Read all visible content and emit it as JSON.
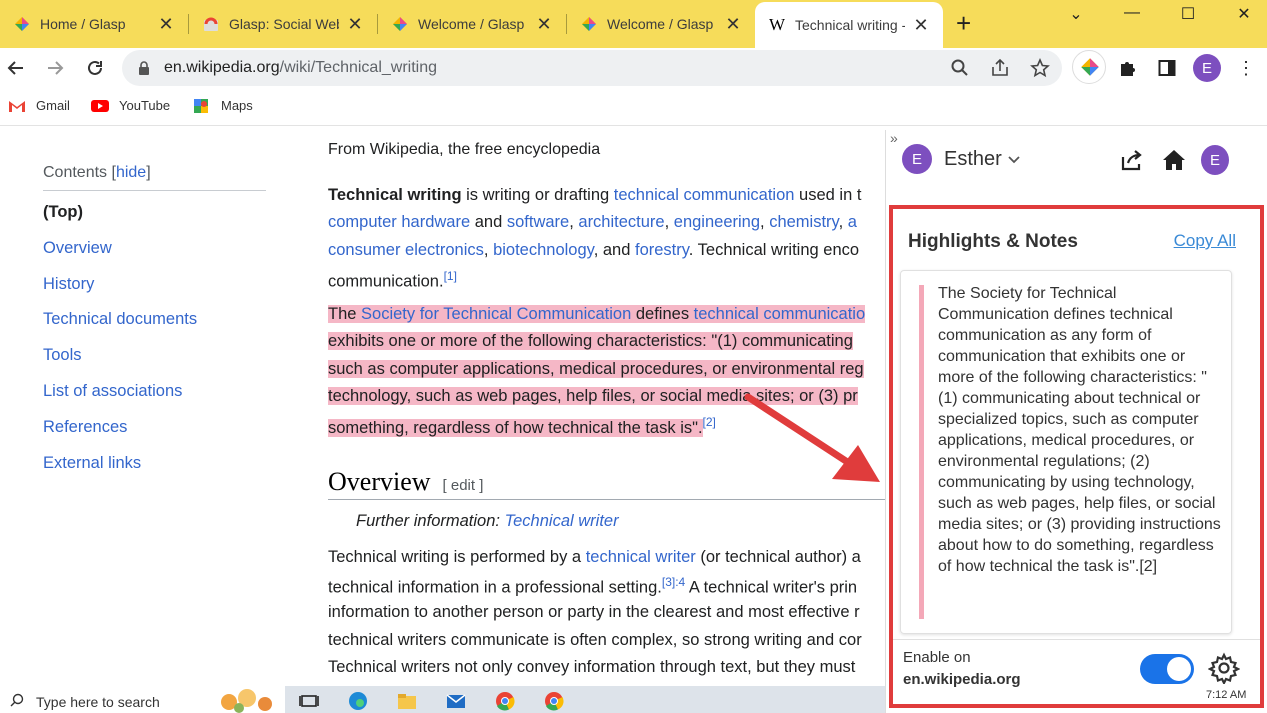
{
  "browser": {
    "tabs": [
      {
        "title": "Home / Glasp",
        "icon": "glasp-icon"
      },
      {
        "title": "Glasp: Social Web",
        "icon": "chrome-store-icon"
      },
      {
        "title": "Welcome / Glasp",
        "icon": "glasp-icon"
      },
      {
        "title": "Welcome / Glasp",
        "icon": "glasp-icon"
      },
      {
        "title": "Technical writing -",
        "icon": "wikipedia-icon"
      }
    ],
    "new_tab": "+",
    "window_controls": {
      "collapse": "⌄",
      "minimize": "—",
      "maximize": "☐",
      "close": "✕"
    },
    "url_host": "en.wikipedia.org",
    "url_path": "/wiki/Technical_writing",
    "profile_initial": "E",
    "bookmarks": [
      {
        "label": "Gmail",
        "icon": "gmail-icon"
      },
      {
        "label": "YouTube",
        "icon": "youtube-icon"
      },
      {
        "label": "Maps",
        "icon": "maps-icon"
      }
    ]
  },
  "wiki": {
    "toc": {
      "heading": "Contents",
      "toggle": "hide",
      "items": [
        "(Top)",
        "Overview",
        "History",
        "Technical documents",
        "Tools",
        "List of associations",
        "References",
        "External links"
      ]
    },
    "tagline": "From Wikipedia, the free encyclopedia",
    "p1": {
      "bold": "Technical writing",
      "t1": " is writing or drafting ",
      "l1": "technical communication",
      "t2": " used in t",
      "l2": "computer hardware",
      "t3": " and ",
      "l3": "software",
      "t4": ", ",
      "l4": "architecture",
      "t5": ", ",
      "l5": "engineering",
      "t6": ", ",
      "l6": "chemistry",
      "t7": ", ",
      "l7": "a",
      "l8": "consumer electronics",
      "t8": ", ",
      "l9": "biotechnology",
      "t9": ", and ",
      "l10": "forestry",
      "t10": ". Technical writing enco",
      "t11": "communication.",
      "sup": "[1]"
    },
    "p2": {
      "t1": "The ",
      "l1": "Society for Technical Communication",
      "t2": " defines ",
      "l2": "technical communicatio",
      "line2": "exhibits one or more of the following characteristics: \"(1) communicating ",
      "line3": "such as computer applications, medical procedures, or environmental reg",
      "line4": "technology, such as web pages, help files, or social media sites; or (3) pr",
      "line5": "something, regardless of how technical the task is\".",
      "sup": "[2]"
    },
    "overview": {
      "heading": "Overview",
      "edit": "[ edit ]",
      "further_label": "Further information: ",
      "further_link": "Technical writer",
      "l1a": "Technical writing is performed by a ",
      "l1b": "technical writer",
      "l1c": " (or technical author) a",
      "l2a": "technical information in a professional setting.",
      "l2sup": "[3]:4",
      "l2b": " A technical writer's prin",
      "l3": "information to another person or party in the clearest and most effective r",
      "l4": "technical writers communicate is often complex, so strong writing and cor",
      "l5": "Technical writers not only convey information through text, but they must"
    }
  },
  "glasp": {
    "collapse": "»",
    "user_initial": "E",
    "user_name": "Esther",
    "panel_title": "Highlights & Notes",
    "copy_all": "Copy All",
    "highlight": "The Society for Technical Communication defines technical communication as any form of communication that exhibits one or more of the following characteristics: \"(1) communicating about technical or specialized topics, such as computer applications, medical procedures, or environmental regulations; (2) communicating by using technology, such as web pages, help files, or social media sites; or (3) providing instructions about how to do something, regardless of how technical the task is\".[2]",
    "enable_label": "Enable on",
    "enable_domain": "en.wikipedia.org",
    "toggle_on": true
  },
  "taskbar": {
    "search_placeholder": "Type here to search",
    "clock": "7:12 AM"
  },
  "colors": {
    "tabstrip": "#f6dc5a",
    "highlight": "#f5b7c6",
    "link": "#3366cc",
    "annotation_red": "#e03c3c",
    "toggle": "#1a73e8"
  }
}
